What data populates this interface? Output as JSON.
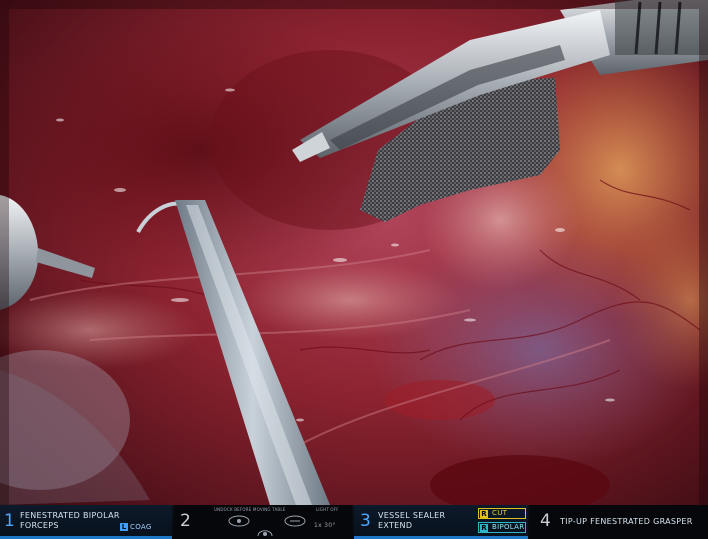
{
  "status_bar": {
    "arm1": {
      "number": "1",
      "line1": "FENESTRATED BIPOLAR",
      "line2": "FORCEPS",
      "energy_mode": "COAG",
      "accent_color": "#1e78c8"
    },
    "arm2": {
      "number": "2",
      "left_note": "UNDOCK BEFORE MOVING TABLE",
      "right_note": "LIGHT OFF",
      "scope_angle": "1x 30°"
    },
    "arm3": {
      "number": "3",
      "line1": "VESSEL SEALER",
      "line2": "EXTEND",
      "mode_top": "CUT",
      "mode_top_key": "R",
      "mode_bottom": "BIPOLAR",
      "mode_bottom_key": "R",
      "accent_color": "#1e78c8",
      "mode_top_color": "#e0c020",
      "mode_bottom_color": "#2fb6c8"
    },
    "arm4": {
      "number": "4",
      "label": "TIP-UP FENESTRATED GRASPER"
    }
  },
  "scene": {
    "instruments": [
      "fenestrated-bipolar-forceps",
      "vessel-sealer",
      "retraction-wire",
      "fenestrated-grasper"
    ],
    "mesh": "surgical-gauze",
    "tissue_color": "#8c2330"
  }
}
